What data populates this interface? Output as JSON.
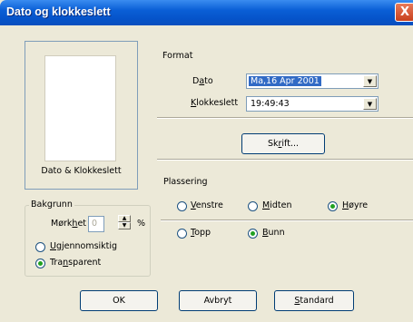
{
  "window": {
    "title": "Dato og klokkeslett",
    "close_glyph": "X"
  },
  "preview": {
    "caption": "Dato & Klokkeslett"
  },
  "format": {
    "group_label": "Format",
    "date": {
      "label_pre": "D",
      "label_u": "a",
      "label_post": "to",
      "value": "Ma,16 Apr 2001"
    },
    "time": {
      "label_pre": "",
      "label_u": "K",
      "label_post": "lokkeslett",
      "value": "19:49:43"
    },
    "font_button": {
      "pre": "Sk",
      "u": "r",
      "post": "ift..."
    }
  },
  "placement": {
    "group_label": "Plassering",
    "horizontal": [
      {
        "pre": "",
        "u": "V",
        "post": "enstre",
        "checked": false
      },
      {
        "pre": "",
        "u": "M",
        "post": "idten",
        "checked": false
      },
      {
        "pre": "",
        "u": "H",
        "post": "øyre",
        "checked": true
      }
    ],
    "vertical": [
      {
        "pre": "",
        "u": "T",
        "post": "opp",
        "checked": false
      },
      {
        "pre": "",
        "u": "B",
        "post": "unn",
        "checked": true
      }
    ]
  },
  "background": {
    "group_label": "Bakgrunn",
    "darkness": {
      "pre": "Mørk",
      "u": "h",
      "post": "et",
      "value": "0",
      "unit": "%"
    },
    "options": [
      {
        "pre": "",
        "u": "U",
        "post": "gjennomsiktig",
        "checked": false
      },
      {
        "pre": "Tra",
        "u": "n",
        "post": "sparent",
        "checked": true
      }
    ]
  },
  "buttons": {
    "ok": "OK",
    "cancel": "Avbryt",
    "standard": {
      "pre": "",
      "u": "S",
      "post": "tandard"
    }
  },
  "icons": {
    "dropdown": "▼",
    "spin_up": "▲",
    "spin_down": "▼"
  }
}
